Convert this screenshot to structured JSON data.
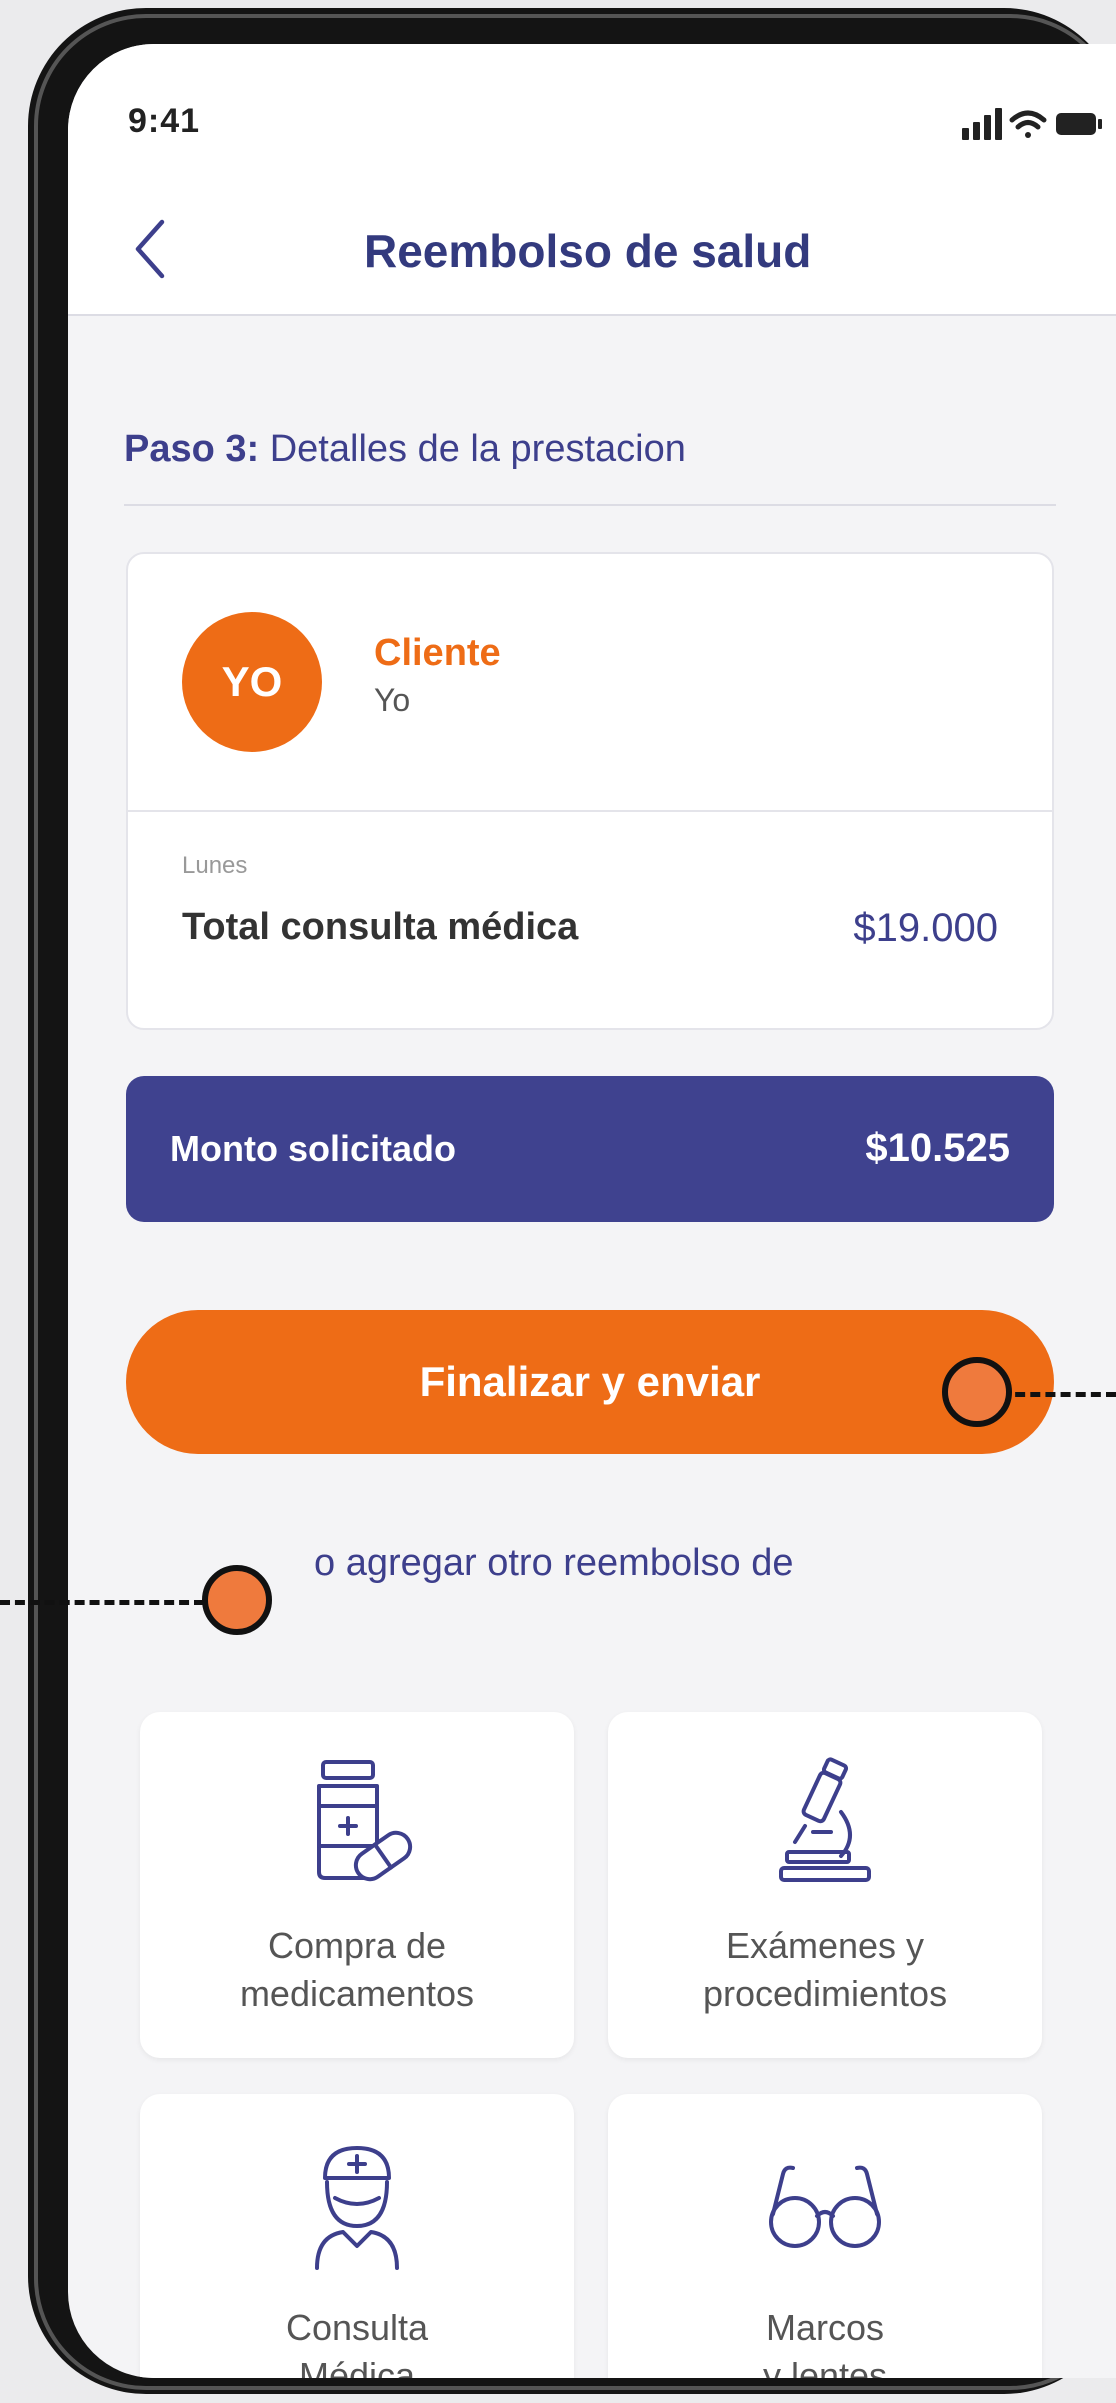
{
  "status": {
    "time": "9:41",
    "icons": [
      "signal-icon",
      "wifi-icon",
      "battery-icon"
    ]
  },
  "nav": {
    "back_icon": "chevron-left-icon",
    "title": "Reembolso de salud"
  },
  "step": {
    "number": "Paso 3:",
    "title": "Detalles de la prestacion"
  },
  "client_card": {
    "avatar": "YO",
    "label": "Cliente",
    "name": "Yo",
    "day": "Lunes",
    "total_label": "Total consulta médica",
    "total_value": "$19.000"
  },
  "requested": {
    "label": "Monto solicitado",
    "value": "$10.525"
  },
  "finish_button": "Finalizar y enviar",
  "add_other_text": "o agregar otro reembolso de",
  "categories": [
    {
      "icon": "medicine-bottle-icon",
      "line1": "Compra de",
      "line2": "medicamentos"
    },
    {
      "icon": "microscope-icon",
      "line1": "Exámenes y",
      "line2": "procedimientos"
    },
    {
      "icon": "doctor-icon",
      "line1": "Consulta",
      "line2": "Médica"
    },
    {
      "icon": "glasses-icon",
      "line1": "Marcos",
      "line2": "y lentes"
    }
  ],
  "colors": {
    "primary": "#3f428f",
    "accent": "#ee6c16",
    "background": "#f4f4f6"
  }
}
